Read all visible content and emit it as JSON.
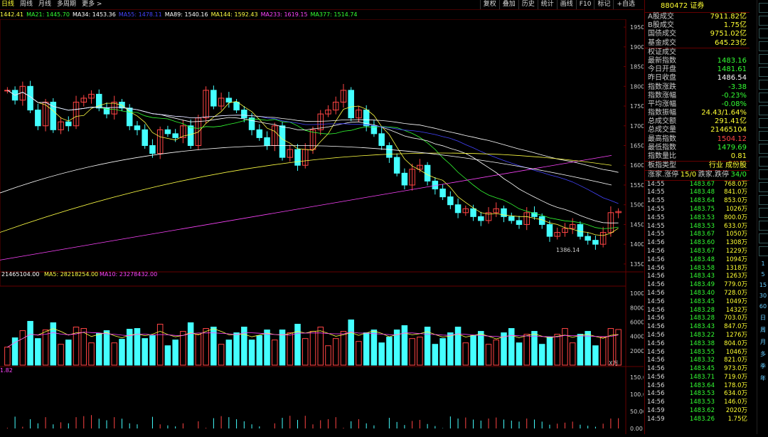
{
  "tabs": [
    "日线",
    "周线",
    "月线",
    "多周期",
    "更多 >"
  ],
  "toolbar": [
    "复权",
    "叠加",
    "历史",
    "统计",
    "画线",
    "F10",
    "标记",
    "+自选"
  ],
  "ma_line": [
    {
      "label": "1442.41",
      "color": "#ff4"
    },
    {
      "label": "MA21: 1445.70",
      "color": "#3f3"
    },
    {
      "label": "MA34: 1453.36",
      "color": "#fff"
    },
    {
      "label": "MA55: 1478.11",
      "color": "#44f"
    },
    {
      "label": "MA89: 1540.16",
      "color": "#fff"
    },
    {
      "label": "MA144: 1592.43",
      "color": "#ff4"
    },
    {
      "label": "MA233: 1619.15",
      "color": "#f4f"
    },
    {
      "label": "MA377: 1514.74",
      "color": "#3f3"
    }
  ],
  "vol_line": [
    {
      "label": "21465104.00",
      "color": "#fff"
    },
    {
      "label": "MA5: 28218254.00",
      "color": "#ff4"
    },
    {
      "label": "MA10: 23278432.00",
      "color": "#f4f"
    }
  ],
  "price_axis": [
    "1950",
    "1900",
    "1850",
    "1800",
    "1750",
    "1700",
    "1650",
    "1600",
    "1550",
    "1500",
    "1450",
    "1400",
    "1350"
  ],
  "vol_axis": [
    "10000",
    "8000",
    "6000",
    "4000",
    "2000"
  ],
  "vol_unit": "X万",
  "ind_axis": [
    "150.00",
    "100.00",
    "50.00",
    "0.00"
  ],
  "ind_label": "1.82",
  "low_label": "1386.14",
  "panel": {
    "code": "880472 证券",
    "rows": [
      {
        "k": "A股成交",
        "v": "7911.82亿",
        "c": ""
      },
      {
        "k": "B股成交",
        "v": "1.75亿",
        "c": ""
      },
      {
        "k": "国债成交",
        "v": "9751.02亿",
        "c": ""
      },
      {
        "k": "基金成交",
        "v": "645.23亿",
        "c": ""
      },
      {
        "k": "权证成交",
        "v": "",
        "c": ""
      },
      {
        "k": "最新指数",
        "v": "1483.16",
        "c": "green"
      },
      {
        "k": "今日开盘",
        "v": "1481.61",
        "c": "green"
      },
      {
        "k": "昨日收盘",
        "v": "1486.54",
        "c": "white"
      },
      {
        "k": "指数涨跌",
        "v": "-3.38",
        "c": "green"
      },
      {
        "k": "指数涨幅",
        "v": "-0.23%",
        "c": "green"
      },
      {
        "k": "平均涨幅",
        "v": "-0.08%",
        "c": "green"
      },
      {
        "k": "指数振幅",
        "v": "24.43/1.64%",
        "c": ""
      },
      {
        "k": "总成交额",
        "v": "291.41亿",
        "c": ""
      },
      {
        "k": "总成交量",
        "v": "21465104",
        "c": ""
      },
      {
        "k": "最高指数",
        "v": "1504.12",
        "c": "red"
      },
      {
        "k": "最低指数",
        "v": "1479.69",
        "c": "green"
      },
      {
        "k": "指数量比",
        "v": "0.81",
        "c": ""
      }
    ],
    "sector": {
      "k": "板指类型",
      "v": "行业 成份股"
    },
    "updown": {
      "a": "涨家.涨停",
      "b": "15/0",
      "c": "跌家.跌停",
      "d": "34/0"
    }
  },
  "ticks": [
    {
      "t": "14:55",
      "p": "1483.67",
      "q": "768.0万"
    },
    {
      "t": "14:55",
      "p": "1483.48",
      "q": "841.0万"
    },
    {
      "t": "14:55",
      "p": "1483.64",
      "q": "853.0万"
    },
    {
      "t": "14:55",
      "p": "1483.75",
      "q": "1026万"
    },
    {
      "t": "14:55",
      "p": "1483.53",
      "q": "800.0万"
    },
    {
      "t": "14:55",
      "p": "1483.53",
      "q": "633.0万"
    },
    {
      "t": "14:55",
      "p": "1483.67",
      "q": "1050万"
    },
    {
      "t": "14:56",
      "p": "1483.60",
      "q": "1308万"
    },
    {
      "t": "14:56",
      "p": "1483.67",
      "q": "1229万"
    },
    {
      "t": "14:56",
      "p": "1483.48",
      "q": "1094万"
    },
    {
      "t": "14:56",
      "p": "1483.58",
      "q": "1318万"
    },
    {
      "t": "14:56",
      "p": "1483.43",
      "q": "1263万"
    },
    {
      "t": "14:56",
      "p": "1483.49",
      "q": "779.0万"
    },
    {
      "t": "14:56",
      "p": "1483.40",
      "q": "728.0万"
    },
    {
      "t": "14:56",
      "p": "1483.45",
      "q": "1049万"
    },
    {
      "t": "14:56",
      "p": "1483.28",
      "q": "1432万"
    },
    {
      "t": "14:56",
      "p": "1483.28",
      "q": "703.0万"
    },
    {
      "t": "14:56",
      "p": "1483.43",
      "q": "847.0万"
    },
    {
      "t": "14:56",
      "p": "1483.22",
      "q": "1276万"
    },
    {
      "t": "14:56",
      "p": "1483.38",
      "q": "804.0万"
    },
    {
      "t": "14:56",
      "p": "1483.55",
      "q": "1046万"
    },
    {
      "t": "14:56",
      "p": "1483.32",
      "q": "821.0万"
    },
    {
      "t": "14:56",
      "p": "1483.45",
      "q": "973.0万"
    },
    {
      "t": "14:56",
      "p": "1483.71",
      "q": "719.0万"
    },
    {
      "t": "14:56",
      "p": "1483.64",
      "q": "178.0万"
    },
    {
      "t": "14:56",
      "p": "1483.53",
      "q": "634.0万"
    },
    {
      "t": "14:56",
      "p": "1483.53",
      "q": "146.0万"
    },
    {
      "t": "14:59",
      "p": "1483.62",
      "q": "2020万"
    },
    {
      "t": "14:59",
      "p": "1483.26",
      "q": "1.75亿"
    }
  ],
  "sidebar_text": [
    "1",
    "5",
    "15",
    "30",
    "60",
    "日",
    "周",
    "月",
    "多",
    "季",
    "年"
  ],
  "chart_data": {
    "type": "candlestick",
    "y_range": [
      1330,
      1970
    ],
    "low_marker": 1386.14,
    "closes": [
      1790,
      1765,
      1800,
      1740,
      1700,
      1760,
      1690,
      1710,
      1700,
      1760,
      1770,
      1780,
      1745,
      1730,
      1760,
      1745,
      1700,
      1690,
      1650,
      1630,
      1690,
      1680,
      1670,
      1700,
      1650,
      1720,
      1790,
      1750,
      1770,
      1760,
      1740,
      1720,
      1690,
      1670,
      1650,
      1700,
      1620,
      1640,
      1600,
      1640,
      1690,
      1730,
      1740,
      1760,
      1790,
      1720,
      1740,
      1700,
      1680,
      1650,
      1620,
      1580,
      1550,
      1590,
      1600,
      1560,
      1540,
      1520,
      1500,
      1480,
      1490,
      1470,
      1460,
      1480,
      1490,
      1470,
      1460,
      1450,
      1480,
      1470,
      1450,
      1420,
      1430,
      1440,
      1450,
      1420,
      1410,
      1400,
      1430,
      1480,
      1483
    ]
  }
}
